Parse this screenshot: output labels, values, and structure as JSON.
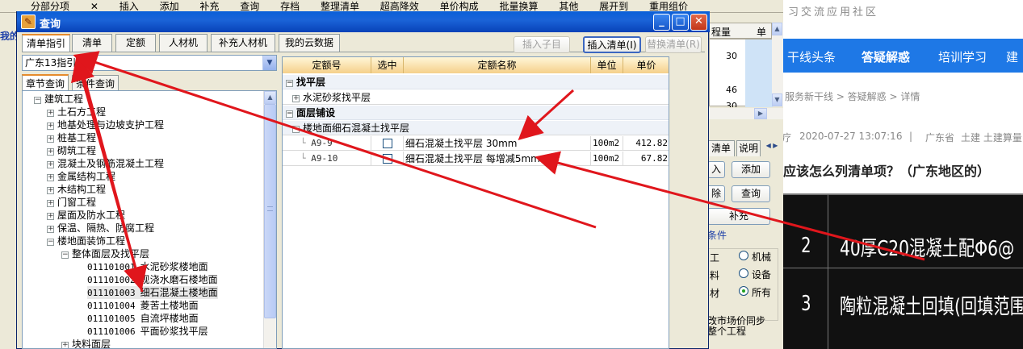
{
  "background_app": {
    "toolbar_items": [
      "分部分项",
      "✕",
      "插入",
      "添加",
      "补充",
      "查询",
      "存档",
      "整理清单",
      "超高降效",
      "单价构成",
      "批量换算",
      "其他",
      "展开到",
      "重用组价"
    ],
    "left_edge_text": "我的",
    "grid": {
      "header": [
        "程量",
        "单"
      ],
      "values": [
        "30",
        "46",
        "30"
      ]
    },
    "tabs": [
      "清单",
      "说明"
    ],
    "buttons": [
      "入",
      "添加",
      "除",
      "查询",
      "补充"
    ],
    "filter_label": "条件",
    "radio_left": [
      "工",
      "料",
      "材"
    ],
    "radios": [
      {
        "label": "机械",
        "checked": false
      },
      {
        "label": "设备",
        "checked": false
      },
      {
        "label": "所有",
        "checked": true
      }
    ],
    "footer_text": [
      "改市场价同步",
      "整个工程"
    ]
  },
  "web_page": {
    "site_name": "习交流应用社区",
    "nav": [
      "干线头条",
      "答疑解惑",
      "培训学习",
      "建"
    ],
    "breadcrumb": "服务新干线 > 答疑解惑 > 详情",
    "meta": {
      "prefix": "疗",
      "datetime": "2020-07-27 13:07:16",
      "separator": "|",
      "region": "广东省",
      "tags": "土建 土建算量"
    },
    "question": "应该怎么列清单项？（广东地区的）",
    "image_rows": [
      {
        "num": "2",
        "text": "40厚C20混凝土配Φ6@"
      },
      {
        "num": "3",
        "text": "陶粒混凝土回填(回填范围、"
      }
    ]
  },
  "dialog": {
    "title": "查询",
    "window_buttons": [
      "_",
      "□",
      "✕"
    ],
    "tabs": [
      {
        "label": "清单指引",
        "active": true
      },
      {
        "label": "清单",
        "active": false
      },
      {
        "label": "定额",
        "active": false
      },
      {
        "label": "人材机",
        "active": false
      },
      {
        "label": "补充人材机",
        "active": false
      },
      {
        "label": "我的云数据",
        "active": false
      }
    ],
    "actions": {
      "insert_child": "插入子目",
      "insert_list": "插入清单(I)",
      "replace_list": "替换清单(R)"
    },
    "combo_value": "广东13指引",
    "subtabs": [
      "章节查询",
      "条件查询"
    ],
    "tree": [
      {
        "label": "建筑工程",
        "level": 0,
        "expander": "-"
      },
      {
        "label": "土石方工程",
        "level": 1,
        "expander": "+"
      },
      {
        "label": "地基处理与边坡支护工程",
        "level": 1,
        "expander": "+"
      },
      {
        "label": "桩基工程",
        "level": 1,
        "expander": "+"
      },
      {
        "label": "砌筑工程",
        "level": 1,
        "expander": "+"
      },
      {
        "label": "混凝土及钢筋混凝土工程",
        "level": 1,
        "expander": "+"
      },
      {
        "label": "金属结构工程",
        "level": 1,
        "expander": "+"
      },
      {
        "label": "木结构工程",
        "level": 1,
        "expander": "+"
      },
      {
        "label": "门窗工程",
        "level": 1,
        "expander": "+"
      },
      {
        "label": "屋面及防水工程",
        "level": 1,
        "expander": "+"
      },
      {
        "label": "保温、隔热、防腐工程",
        "level": 1,
        "expander": "+"
      },
      {
        "label": "楼地面装饰工程",
        "level": 1,
        "expander": "-"
      },
      {
        "label": "整体面层及找平层",
        "level": 2,
        "expander": "-"
      },
      {
        "code": "011101001",
        "label": "水泥砂浆楼地面",
        "level": 3
      },
      {
        "code": "011101002",
        "label": "现浇水磨石楼地面",
        "level": 3
      },
      {
        "code": "011101003",
        "label": "细石混凝土楼地面",
        "level": 3,
        "selected": true
      },
      {
        "code": "011101004",
        "label": "菱苦土楼地面",
        "level": 3
      },
      {
        "code": "011101005",
        "label": "自流坪楼地面",
        "level": 3
      },
      {
        "code": "011101006",
        "label": "平面砂浆找平层",
        "level": 3
      },
      {
        "label": "块料面层",
        "level": 2,
        "expander": "+"
      }
    ],
    "table": {
      "headers": [
        "定额号",
        "选中",
        "定额名称",
        "单位",
        "单价"
      ],
      "groups": [
        {
          "name": "找平层",
          "children": [
            {
              "label": "水泥砂浆找平层",
              "expander": "+"
            }
          ]
        },
        {
          "name": "面层铺设",
          "children": [
            {
              "label": "楼地面细石混凝土找平层",
              "expander": "-",
              "rows": [
                {
                  "code": "A9-9",
                  "checked": false,
                  "name": "细石混凝土找平层 30mm",
                  "unit": "100m2",
                  "price": "412.82"
                },
                {
                  "code": "A9-10",
                  "checked": false,
                  "name": "细石混凝土找平层 每增减5mm",
                  "unit": "100m2",
                  "price": "67.82"
                }
              ]
            }
          ]
        }
      ]
    }
  },
  "colors": {
    "annotation_arrow": "#e0161c",
    "title_bar": "#0a5fd8",
    "web_nav": "#1e78e6"
  }
}
